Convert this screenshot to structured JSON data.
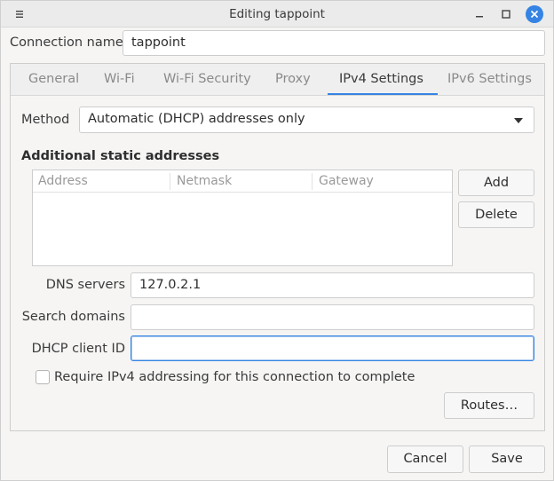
{
  "window": {
    "title": "Editing tappoint",
    "accent_color": "#3584e4"
  },
  "connection": {
    "label": "Connection name",
    "value": "tappoint"
  },
  "tabs": [
    {
      "label": "General",
      "active": false
    },
    {
      "label": "Wi-Fi",
      "active": false
    },
    {
      "label": "Wi-Fi Security",
      "active": false
    },
    {
      "label": "Proxy",
      "active": false
    },
    {
      "label": "IPv4 Settings",
      "active": true
    },
    {
      "label": "IPv6 Settings",
      "active": false
    }
  ],
  "ipv4": {
    "method_label": "Method",
    "method_value": "Automatic (DHCP) addresses only",
    "static_heading": "Additional static addresses",
    "columns": [
      "Address",
      "Netmask",
      "Gateway"
    ],
    "rows": [],
    "add_label": "Add",
    "delete_label": "Delete",
    "dns_label": "DNS servers",
    "dns_value": "127.0.2.1",
    "search_label": "Search domains",
    "search_value": "",
    "dhcp_label": "DHCP client ID",
    "dhcp_value": "",
    "require_label": "Require IPv4 addressing for this connection to complete",
    "require_checked": false,
    "routes_label": "Routes…"
  },
  "footer": {
    "cancel_label": "Cancel",
    "save_label": "Save"
  }
}
